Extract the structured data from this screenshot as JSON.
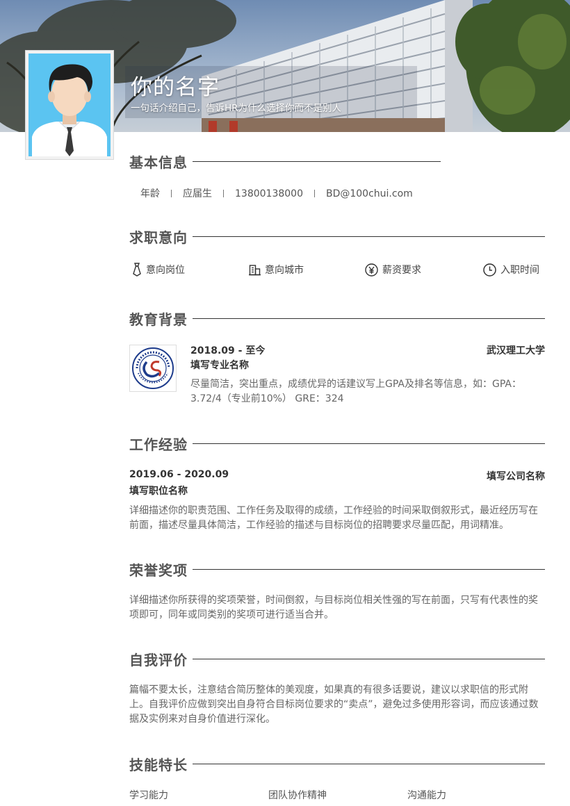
{
  "header": {
    "name": "你的名字",
    "slogan": "一句话介绍自己，告诉HR为什么选择你而不是别人"
  },
  "basic_info": {
    "title": "基本信息",
    "items": [
      "年龄",
      "应届生",
      "13800138000",
      "BD@100chui.com"
    ]
  },
  "job_intention": {
    "title": "求职意向",
    "items": [
      {
        "icon": "tie-icon",
        "label": "意向岗位"
      },
      {
        "icon": "building-icon",
        "label": "意向城市"
      },
      {
        "icon": "yen-icon",
        "label": "薪资要求"
      },
      {
        "icon": "clock-icon",
        "label": "入职时间"
      }
    ]
  },
  "education": {
    "title": "教育背景",
    "period": "2018.09 - 至今",
    "school": "武汉理工大学",
    "major": "填写专业名称",
    "description": "尽量简洁，突出重点，成绩优异的话建议写上GPA及排名等信息，如：GPA：3.72/4（专业前10%） GRE：324"
  },
  "work": {
    "title": "工作经验",
    "period": "2019.06 - 2020.09",
    "company": "填写公司名称",
    "position": "填写职位名称",
    "description": "详细描述你的职责范围、工作任务及取得的成绩，工作经验的时间采取倒叙形式，最近经历写在前面，描述尽量具体简洁，工作经验的描述与目标岗位的招聘要求尽量匹配，用词精准。"
  },
  "honors": {
    "title": "荣誉奖项",
    "description": "详细描述你所获得的奖项荣誉，时间倒叙，与目标岗位相关性强的写在前面，只写有代表性的奖项即可，同年或同类别的奖项可进行适当合并。"
  },
  "self_eval": {
    "title": "自我评价",
    "description": "篇幅不要太长，注意结合简历整体的美观度，如果真的有很多话要说，建议以求职信的形式附上。自我评价应做到突出自身符合目标岗位要求的“卖点”，避免过多使用形容词，而应该通过数据及实例来对自身价值进行深化。"
  },
  "skills": {
    "title": "技能特长",
    "items": [
      "学习能力",
      "团队协作精神",
      "沟通能力"
    ]
  },
  "colors": {
    "accent": "#333333",
    "photo_bg": "#5bc4f1",
    "logo_blue": "#1e3c8c"
  }
}
